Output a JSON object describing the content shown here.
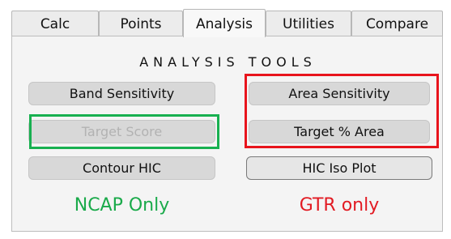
{
  "tabs": [
    "Calc",
    "Points",
    "Analysis",
    "Utilities",
    "Compare"
  ],
  "active_tab": "Analysis",
  "panel": {
    "heading": "ANALYSIS TOOLS",
    "left_buttons": [
      "Band Sensitivity",
      "Target Score",
      "Contour HIC"
    ],
    "right_buttons": [
      "Area Sensitivity",
      "Target % Area",
      "HIC Iso Plot"
    ],
    "disabled_button": "Target Score",
    "left_note": "NCAP Only",
    "right_note": "GTR only"
  },
  "colors": {
    "highlight_green": "#18b050",
    "highlight_red": "#e8141c",
    "note_green": "#1aaa4a",
    "note_red": "#e21b23"
  }
}
